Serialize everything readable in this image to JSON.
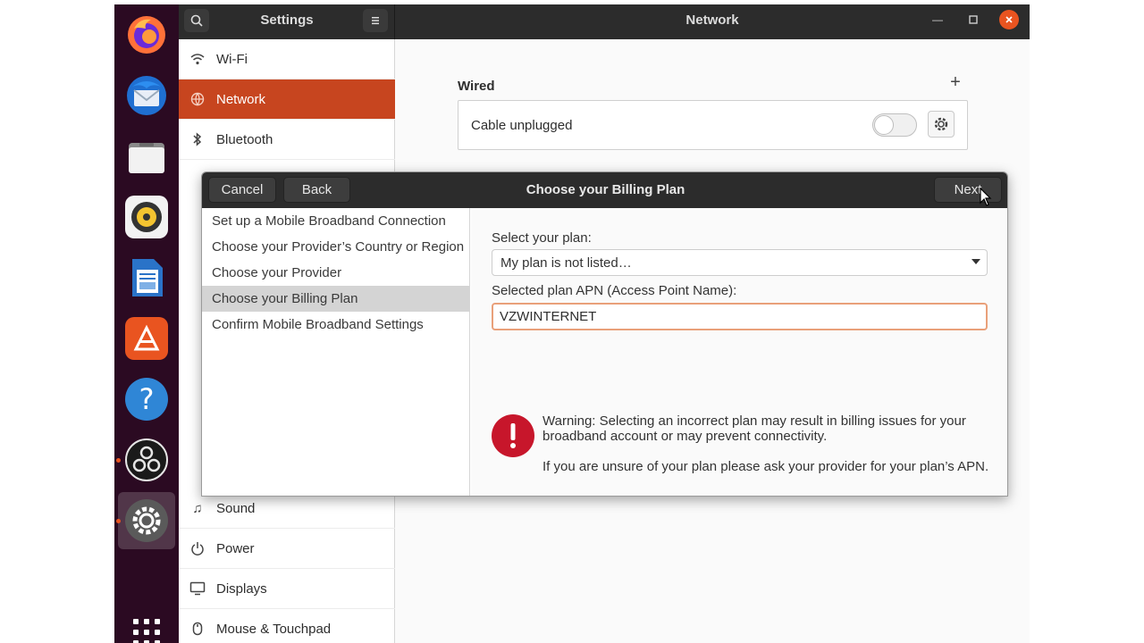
{
  "dock": {
    "apps": [
      {
        "name": "firefox",
        "running": false
      },
      {
        "name": "thunderbird",
        "running": false
      },
      {
        "name": "files",
        "running": false
      },
      {
        "name": "rhythmbox",
        "running": false
      },
      {
        "name": "libreoffice-writer",
        "running": false
      },
      {
        "name": "ubuntu-software",
        "running": false
      },
      {
        "name": "help",
        "running": false
      },
      {
        "name": "obs-studio",
        "running": true
      },
      {
        "name": "settings",
        "running": true,
        "active": true
      }
    ],
    "accent_color": "#e95420"
  },
  "window": {
    "left_title": "Settings",
    "main_title": "Network"
  },
  "sidebar": {
    "items": [
      {
        "label": "Wi-Fi",
        "icon": "wifi-icon"
      },
      {
        "label": "Network",
        "icon": "network-icon",
        "selected": true
      },
      {
        "label": "Bluetooth",
        "icon": "bluetooth-icon"
      },
      {
        "label": "Sound",
        "icon": "music-note-icon"
      },
      {
        "label": "Power",
        "icon": "power-icon"
      },
      {
        "label": "Displays",
        "icon": "display-icon"
      },
      {
        "label": "Mouse & Touchpad",
        "icon": "mouse-icon"
      }
    ],
    "selected_color": "#c7451f"
  },
  "network": {
    "wired_title": "Wired",
    "add_label": "+",
    "cable_status": "Cable unplugged",
    "toggle_on": false
  },
  "dialog": {
    "title": "Choose your Billing Plan",
    "cancel_label": "Cancel",
    "back_label": "Back",
    "next_label": "Next",
    "steps": [
      "Set up a Mobile Broadband Connection",
      "Choose your Provider’s Country or Region",
      "Choose your Provider",
      "Choose your Billing Plan",
      "Confirm Mobile Broadband Settings"
    ],
    "current_step": 3,
    "plan_label": "Select your plan:",
    "plan_value": "My plan is not listed…",
    "apn_label": "Selected plan APN (Access Point Name):",
    "apn_value": "VZWINTERNET",
    "warning_text": "Warning: Selecting an incorrect plan may result in billing issues for your broadband account or may prevent connectivity.",
    "warning_note": "If you are unsure of your plan please ask your provider for your plan’s APN.",
    "warning_color": "#c7162b"
  }
}
